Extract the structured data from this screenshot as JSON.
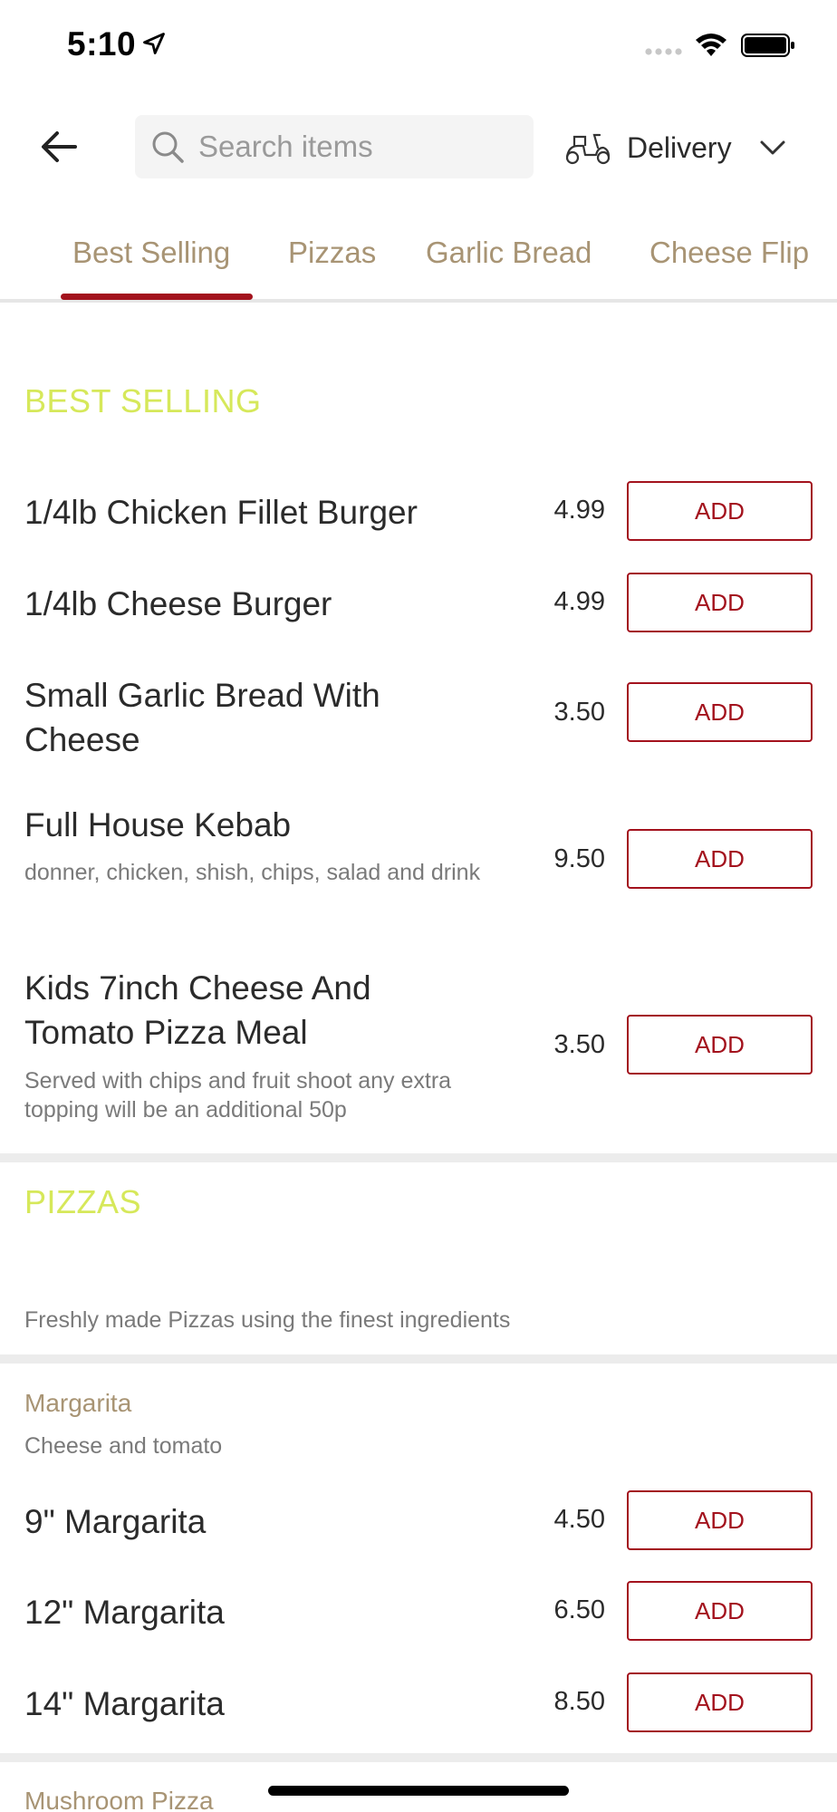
{
  "status_bar": {
    "time": "5:10"
  },
  "search": {
    "placeholder": "Search items"
  },
  "delivery": {
    "label": "Delivery"
  },
  "tabs": [
    {
      "label": "Best Selling",
      "active": true
    },
    {
      "label": "Pizzas"
    },
    {
      "label": "Garlic Bread"
    },
    {
      "label": "Cheese Flip"
    }
  ],
  "best_selling": {
    "title": "BEST SELLING",
    "items": [
      {
        "name": "1/4lb Chicken Fillet Burger",
        "price": "4.99",
        "add": "ADD"
      },
      {
        "name": "1/4lb Cheese Burger",
        "price": "4.99",
        "add": "ADD"
      },
      {
        "name": "Small Garlic Bread With Cheese",
        "price": "3.50",
        "add": "ADD"
      },
      {
        "name": "Full House Kebab",
        "description": "donner, chicken, shish, chips, salad and drink",
        "price": "9.50",
        "add": "ADD"
      },
      {
        "name": "Kids 7inch Cheese And Tomato Pizza Meal",
        "description": "Served with chips and fruit shoot any extra topping will be an additional 50p",
        "price": "3.50",
        "add": "ADD"
      }
    ]
  },
  "pizzas": {
    "title": "PIZZAS",
    "description": "Freshly made Pizzas using the finest ingredients",
    "margarita": {
      "title": "Margarita",
      "description": "Cheese and tomato",
      "items": [
        {
          "name": "9\" Margarita",
          "price": "4.50",
          "add": "ADD"
        },
        {
          "name": "12\" Margarita",
          "price": "6.50",
          "add": "ADD"
        },
        {
          "name": "14\" Margarita",
          "price": "8.50",
          "add": "ADD"
        }
      ]
    },
    "next_group_title": "Mushroom Pizza"
  },
  "colors": {
    "accent": "#a3121d",
    "tab_text": "#a89474",
    "section_title": "#d6e85a"
  }
}
